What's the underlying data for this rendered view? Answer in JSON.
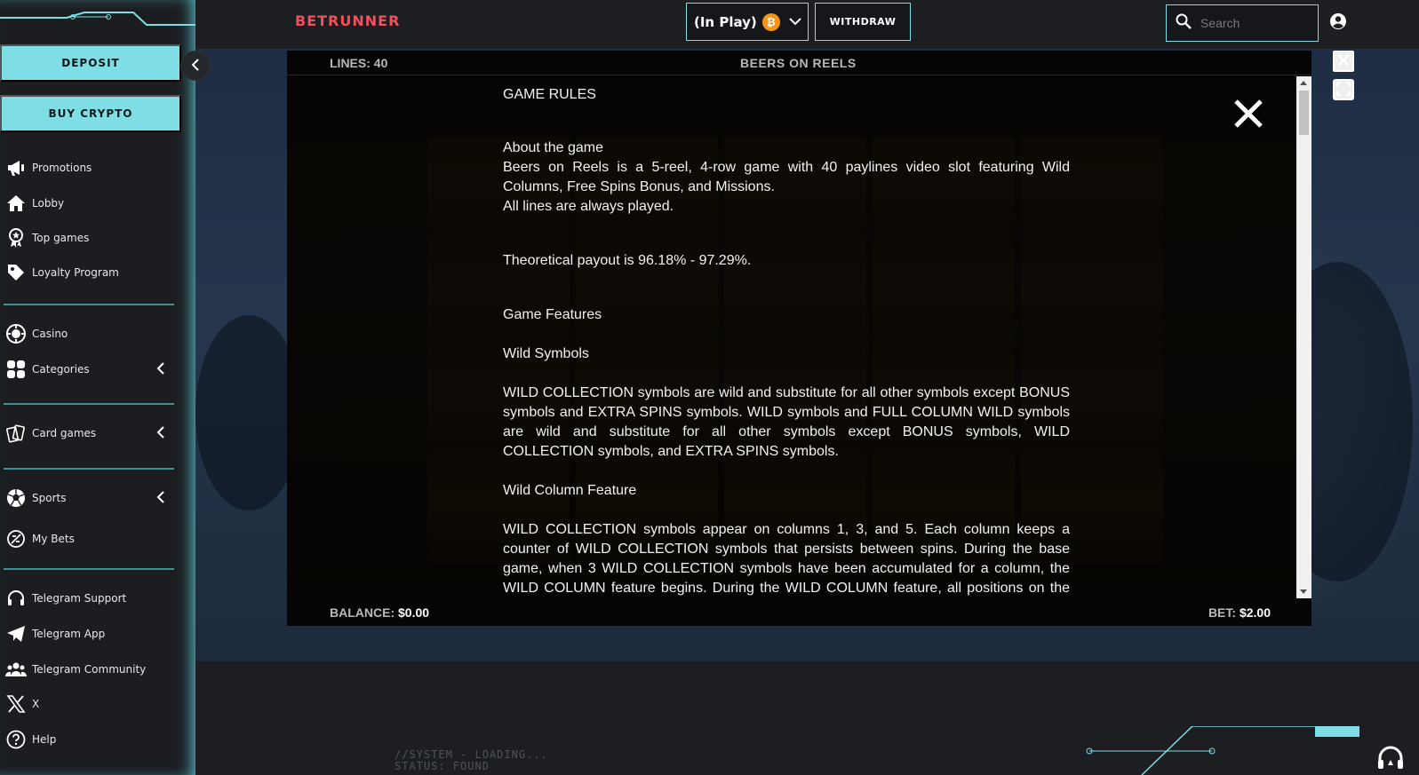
{
  "brand": {
    "name": "BETRUNNER",
    "color": "#f0515a"
  },
  "accent": "#7fdee5",
  "sidebar": {
    "deposit_label": "DEPOSIT",
    "buy_crypto_label": "BUY CRYPTO",
    "items": [
      {
        "label": "Promotions",
        "icon": "megaphone-icon"
      },
      {
        "label": "Lobby",
        "icon": "home-icon"
      },
      {
        "label": "Top games",
        "icon": "star-badge-icon"
      },
      {
        "label": "Loyalty Program",
        "icon": "tag-icon"
      },
      {
        "label": "Casino",
        "icon": "casino-chip-icon"
      },
      {
        "label": "Categories",
        "icon": "grid-icon"
      },
      {
        "label": "Card games",
        "icon": "cards-icon"
      },
      {
        "label": "Sports",
        "icon": "soccer-ball-icon"
      },
      {
        "label": "My Bets",
        "icon": "bets-icon"
      },
      {
        "label": "Telegram Support",
        "icon": "headset-icon"
      },
      {
        "label": "Telegram App",
        "icon": "paper-plane-icon"
      },
      {
        "label": "Telegram Community",
        "icon": "community-icon"
      },
      {
        "label": "X",
        "icon": "x-logo-icon"
      },
      {
        "label": "Help",
        "icon": "help-icon"
      }
    ]
  },
  "topbar": {
    "wallet_label": "(In Play)",
    "currency_symbol": "₿",
    "withdraw_label": "WITHDRAW",
    "search_placeholder": "Search"
  },
  "game": {
    "lines_label": "LINES: 40",
    "title": "BEERS ON REELS",
    "balance_label": "BALANCE:",
    "balance_value": "$0.00",
    "bet_label": "BET:",
    "bet_value": "$2.00"
  },
  "rules": {
    "heading": "GAME RULES",
    "about_heading": "About the game",
    "about_text": "Beers on Reels is a 5-reel, 4-row game with 40 paylines video slot featuring Wild Columns, Free Spins Bonus, and Missions.",
    "about_text2": "All lines are always played.",
    "payout": "Theoretical payout is 96.18% - 97.29%.",
    "features_heading": "Game Features",
    "wild_heading": "Wild Symbols",
    "wild_text": "WILD COLLECTION symbols are wild and substitute for all other symbols except BONUS symbols and EXTRA SPINS symbols. WILD symbols and FULL COLUMN WILD symbols are wild and substitute for all other symbols except BONUS symbols, WILD COLLECTION symbols, and EXTRA SPINS symbols.",
    "column_heading": "Wild Column Feature",
    "column_text": "WILD COLLECTION symbols appear on columns 1, 3, and 5. Each column keeps a counter of WILD COLLECTION symbols that persists between spins. During the base game, when 3 WILD COLLECTION symbols have been accumulated for a column, the WILD COLUMN feature begins. During the WILD COLUMN feature, all positions on the column become wild."
  },
  "footer": {
    "system_line1": "//SYSTEM - LOADING...",
    "system_line2": "STATUS: FOUND"
  }
}
